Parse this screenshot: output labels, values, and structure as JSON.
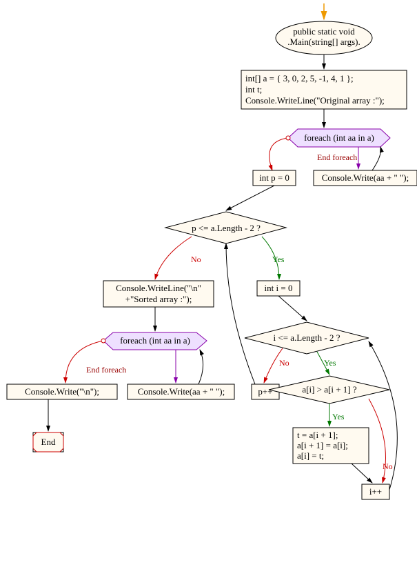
{
  "nodes": {
    "start_label1": "public static void",
    "start_label2": ".Main(string[] args).",
    "init_line1": "int[] a = { 3, 0, 2, 5, -1, 4, 1 };",
    "init_line2": "int t;",
    "init_line3": "Console.WriteLine(\"Original array :\");",
    "foreach1": "foreach (int aa in a)",
    "write1": "Console.Write(aa + \" \");",
    "p_init": "int p = 0",
    "cond1": "p <= a.Length - 2 ?",
    "i_init": "int i = 0",
    "cond2": "i <= a.Length - 2 ?",
    "cond3": "a[i] > a[i + 1] ?",
    "swap_line1": "t = a[i + 1];",
    "swap_line2": "a[i + 1] = a[i];",
    "swap_line3": "a[i] = t;",
    "i_inc": "i++",
    "p_inc": "p++",
    "sorted_line1": "Console.WriteLine(\"\\n\"",
    "sorted_line2": "+\"Sorted array :\");",
    "foreach2": "foreach (int aa in a)",
    "write2": "Console.Write(aa + \" \");",
    "newline": "Console.Write(\"\\n\");",
    "end": "End"
  },
  "labels": {
    "end_foreach": "End foreach",
    "yes": "Yes",
    "no": "No"
  }
}
